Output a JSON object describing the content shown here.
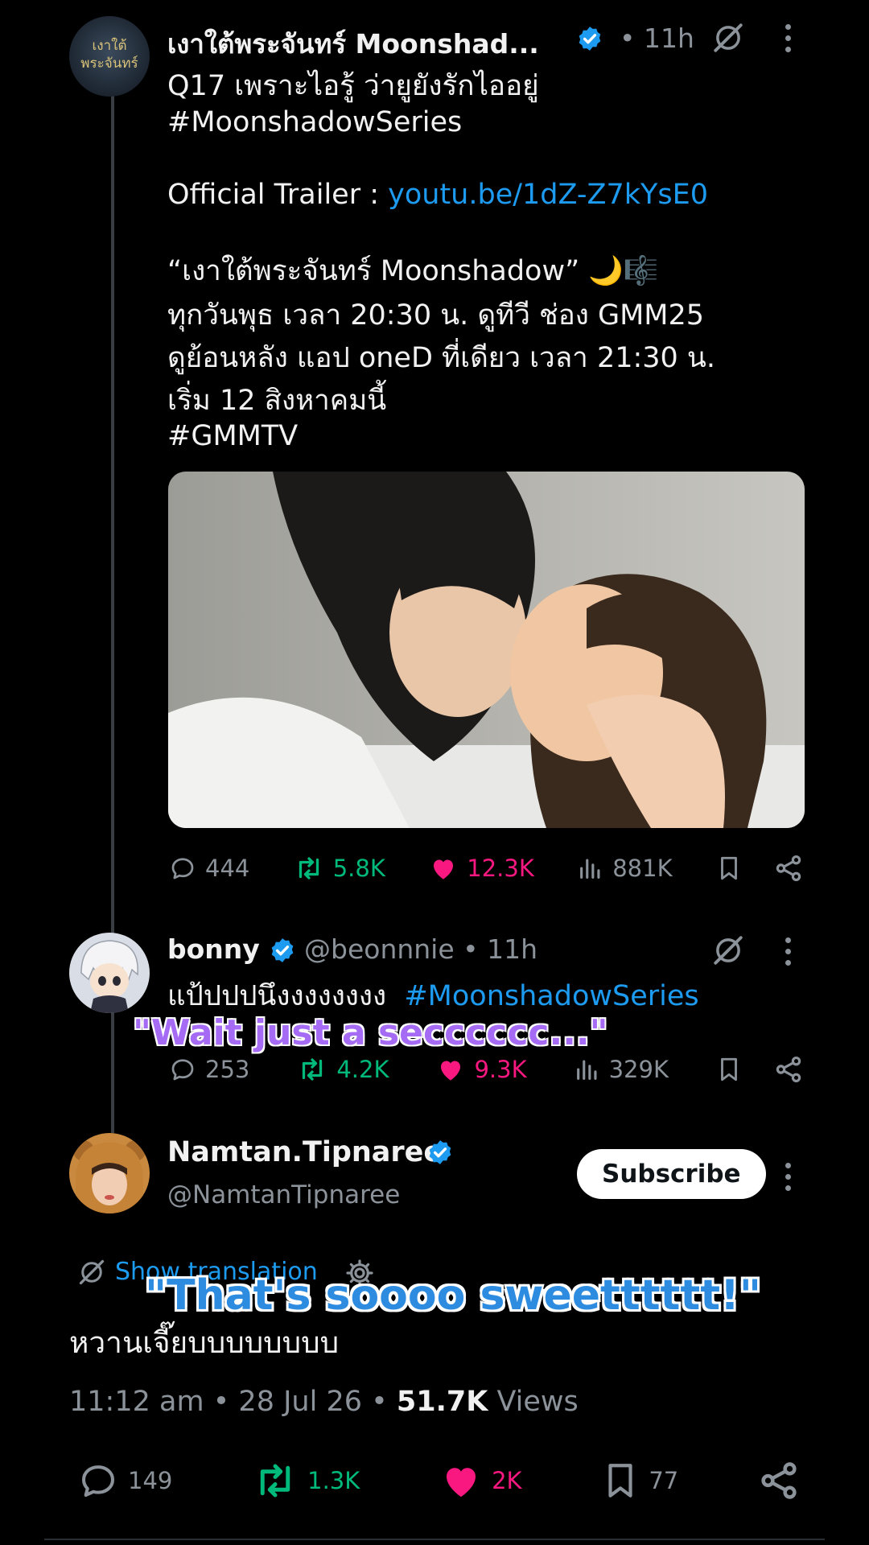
{
  "tweet1": {
    "author_name": "เงาใต้พระจันทร์ Moonshad...",
    "time": "• 11h",
    "avatar_text": "เงาใต้ พระจันทร์",
    "line1": "Q17 เพราะไอรู้ ว่ายูยังรักไออยู่",
    "hashtag1": "#MoonshadowSeries",
    "trailer_label": "Official Trailer : ",
    "trailer_link": "youtu.be/1dZ-Z7kYsE0",
    "line_title": "“เงาใต้พระจันทร์ Moonshadow” 🌙🎼",
    "line_schedule": "ทุกวันพุธ เวลา 20:30 น. ดูทีวี ช่อง GMM25",
    "line_replay": "ดูย้อนหลัง แอป oneD ที่เดียว เวลา 21:30 น.",
    "line_start": "เริ่ม 12 สิงหาคมนี้",
    "hashtag2": "#GMMTV",
    "stats": {
      "replies": "444",
      "reposts": "5.8K",
      "likes": "12.3K",
      "views": "881K"
    }
  },
  "tweet2": {
    "author_name": "bonny",
    "handle_time": "@beonnnie • 11h",
    "text": "แป้ปปปนึงงงงงงงง",
    "hashtag": "#MoonshadowSeries",
    "overlay_caption": "\"Wait just a secccccc...\"",
    "stats": {
      "replies": "253",
      "reposts": "4.2K",
      "likes": "9.3K",
      "views": "329K"
    }
  },
  "tweet3": {
    "author_name": "Namtan.Tipnaree",
    "handle": "@NamtanTipnaree",
    "subscribe_label": "Subscribe",
    "show_translation": "Show translation",
    "overlay_caption": "\"That's soooo sweetttttt!\"",
    "text": "หวานเจี๊ยบบบบบบบบ",
    "time": "11:12 am • 28 Jul 26 • ",
    "views_count": "51.7K",
    "views_label": " Views",
    "stats": {
      "replies": "149",
      "reposts": "1.3K",
      "likes": "2K",
      "bookmarks": "77"
    }
  },
  "colors": {
    "link": "#1d9bf0",
    "repost": "#00ba7c",
    "like": "#f91880",
    "muted": "#8b9299"
  }
}
